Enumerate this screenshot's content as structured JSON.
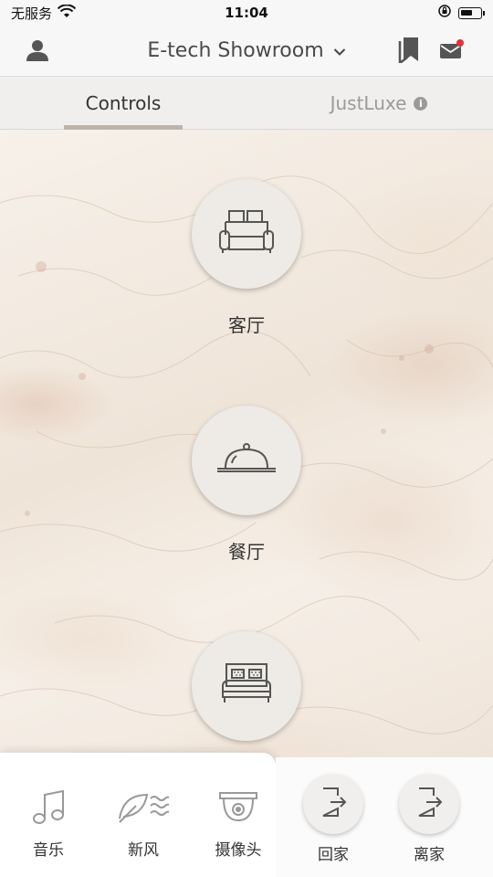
{
  "status_bar": {
    "carrier": "无服务",
    "time": "11:04"
  },
  "header": {
    "title": "E-tech Showroom",
    "icons": [
      "user-icon",
      "chevron-down-icon",
      "bookmark-icon",
      "mail-icon"
    ]
  },
  "tabs": [
    {
      "label": "Controls",
      "active": true
    },
    {
      "label": "JustLuxe",
      "active": false
    }
  ],
  "rooms": [
    {
      "label": "客厅",
      "icon": "sofa-icon"
    },
    {
      "label": "餐厅",
      "icon": "cloche-icon"
    },
    {
      "label": "",
      "icon": "bed-icon"
    }
  ],
  "dock": {
    "functions": [
      {
        "label": "音乐",
        "icon": "music-note-icon"
      },
      {
        "label": "新风",
        "icon": "fresh-air-icon"
      },
      {
        "label": "摄像头",
        "icon": "camera-icon"
      }
    ],
    "scenes": [
      {
        "label": "回家",
        "icon": "door-enter-icon"
      },
      {
        "label": "离家",
        "icon": "door-exit-icon"
      }
    ]
  },
  "colors": {
    "accent_underline": "#bdb5ad",
    "notification_dot": "#e0323a",
    "icon_stroke": "#555555"
  }
}
